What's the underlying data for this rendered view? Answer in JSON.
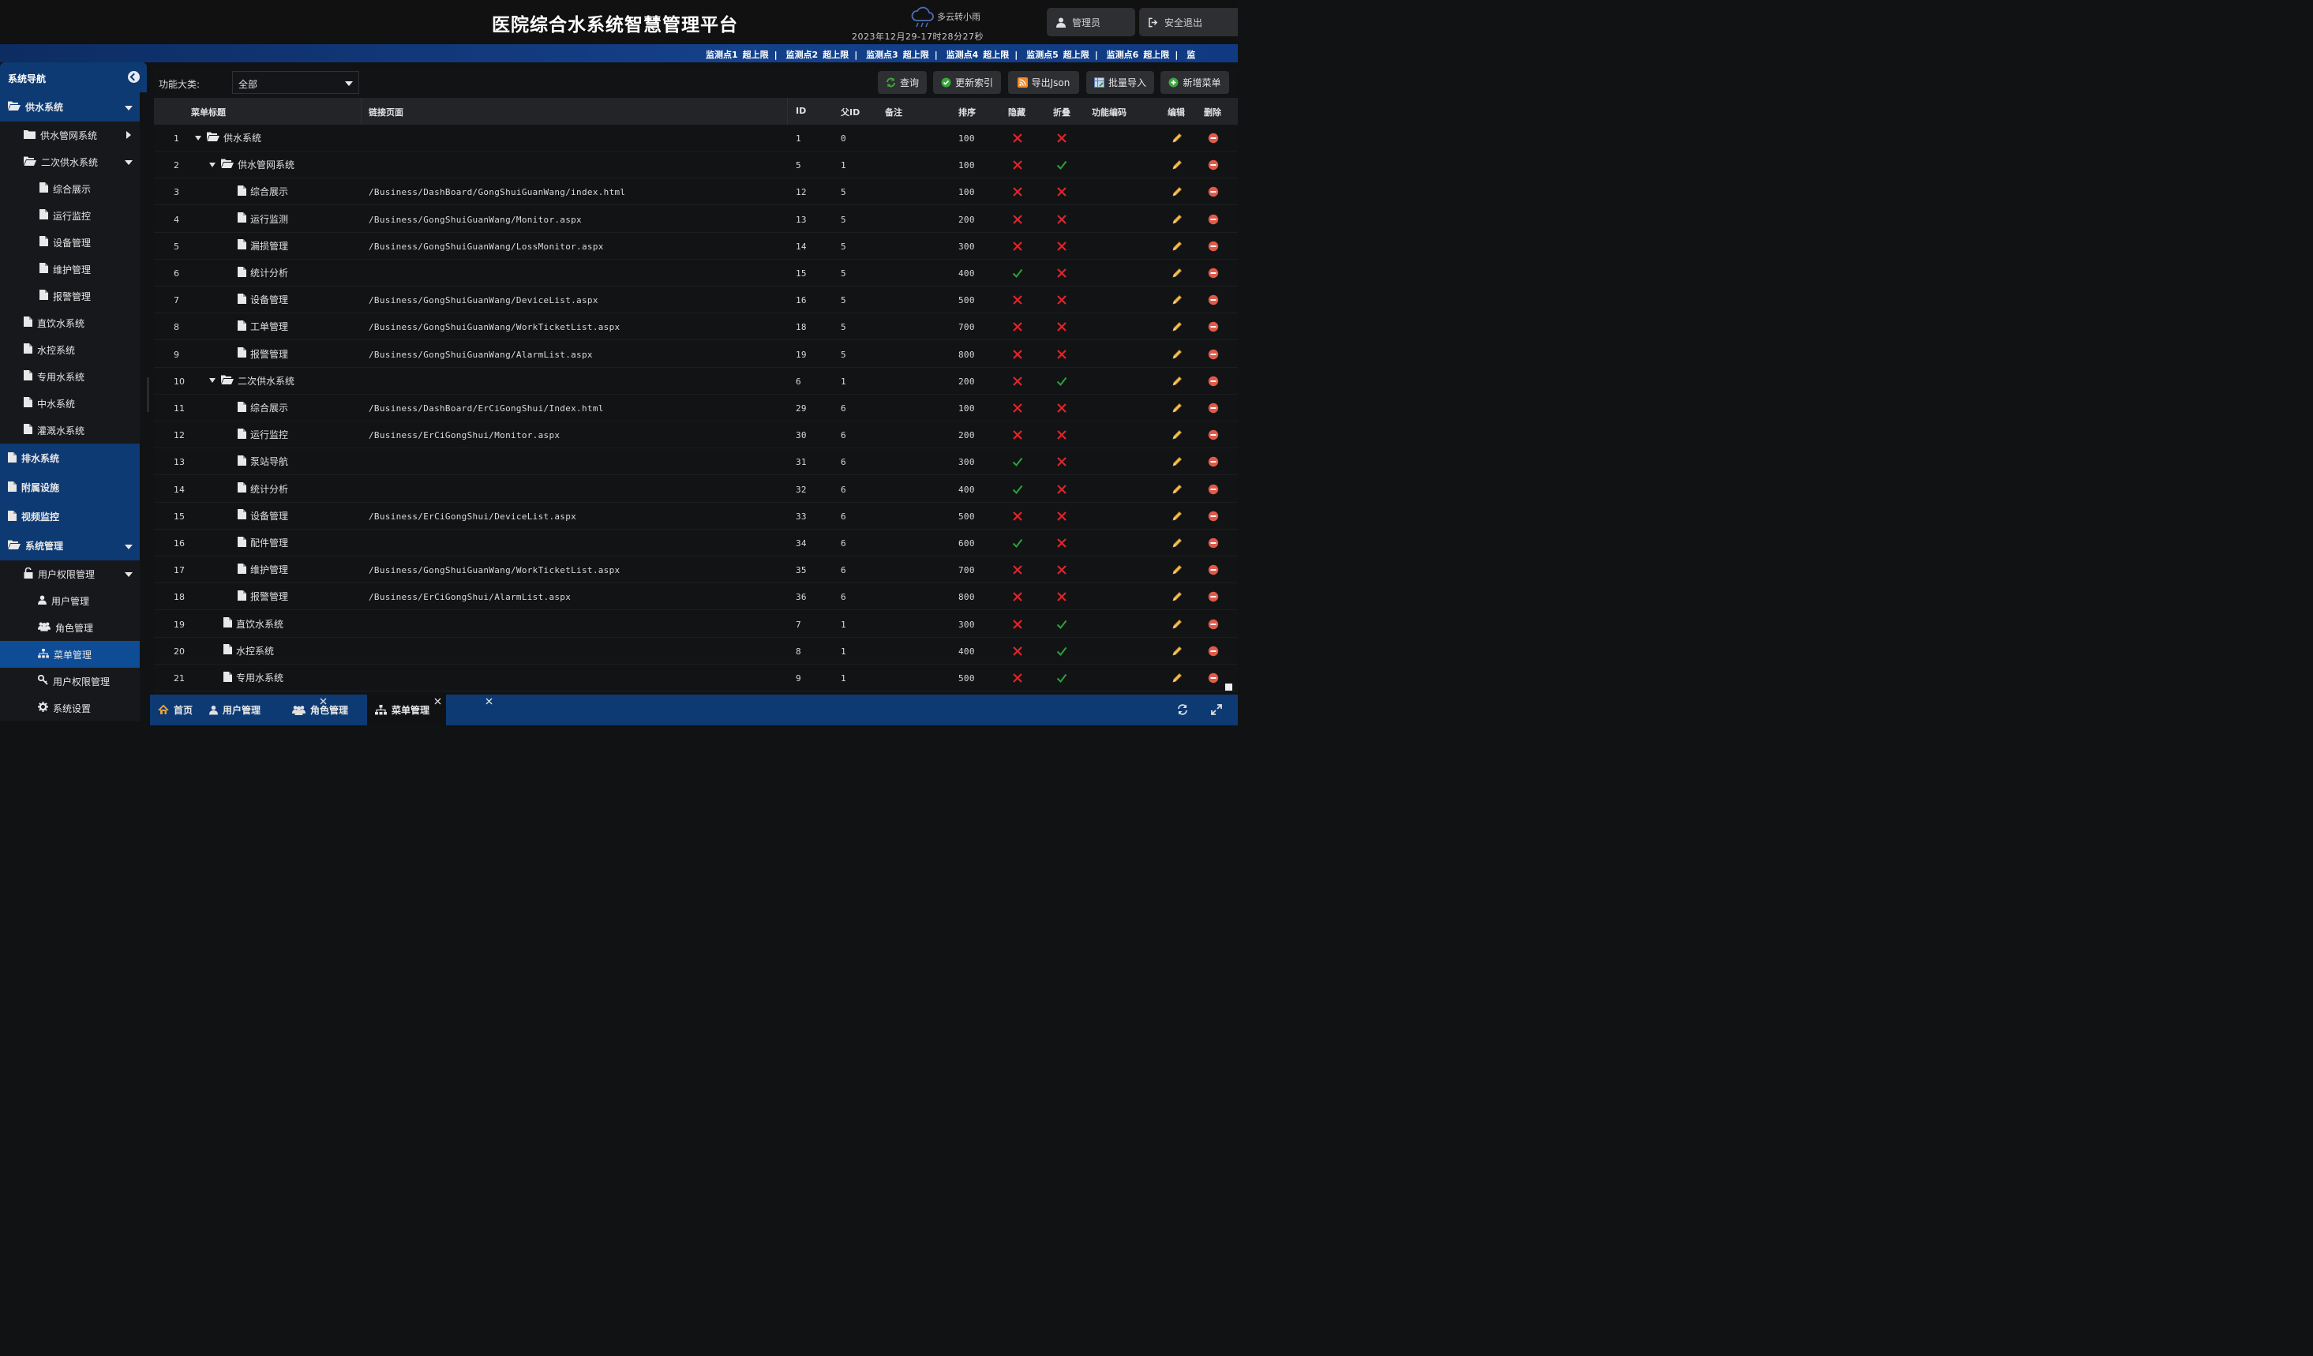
{
  "header": {
    "title": "医院综合水系统智慧管理平台",
    "weather": "多云转小雨",
    "datetime": "2023年12月29-17时28分27秒",
    "user_button": "管理员",
    "logout_button": "安全退出"
  },
  "ticker": {
    "items": [
      {
        "point": "监测点1",
        "status": "超上限"
      },
      {
        "point": "监测点2",
        "status": "超上限"
      },
      {
        "point": "监测点3",
        "status": "超上限"
      },
      {
        "point": "监测点4",
        "status": "超上限"
      },
      {
        "point": "监测点5",
        "status": "超上限"
      },
      {
        "point": "监测点6",
        "status": "超上限"
      }
    ],
    "tail": "监"
  },
  "sidebar": {
    "title": "系统导航",
    "items": [
      {
        "label": "供水系统"
      },
      {
        "label": "供水管网系统"
      },
      {
        "label": "二次供水系统"
      },
      {
        "label": "综合展示"
      },
      {
        "label": "运行监控"
      },
      {
        "label": "设备管理"
      },
      {
        "label": "维护管理"
      },
      {
        "label": "报警管理"
      },
      {
        "label": "直饮水系统"
      },
      {
        "label": "水控系统"
      },
      {
        "label": "专用水系统"
      },
      {
        "label": "中水系统"
      },
      {
        "label": "灌溉水系统"
      },
      {
        "label": "排水系统"
      },
      {
        "label": "附属设施"
      },
      {
        "label": "视频监控"
      },
      {
        "label": "系统管理"
      },
      {
        "label": "用户权限管理"
      },
      {
        "label": "用户管理"
      },
      {
        "label": "角色管理"
      },
      {
        "label": "菜单管理"
      },
      {
        "label": "用户权限管理"
      },
      {
        "label": "系统设置"
      }
    ]
  },
  "toolbar": {
    "filter_label": "功能大类:",
    "filter_value": "全部",
    "buttons": {
      "query": "查询",
      "reindex": "更新索引",
      "export": "导出Json",
      "import": "批量导入",
      "add": "新增菜单"
    }
  },
  "table": {
    "columns": {
      "title": "菜单标题",
      "link": "链接页面",
      "id": "ID",
      "pid": "父ID",
      "note": "备注",
      "sort": "排序",
      "hidden": "隐藏",
      "fold": "折叠",
      "code": "功能编码",
      "edit": "编辑",
      "delete": "删除"
    },
    "rows": [
      {
        "no": "1",
        "title": "供水系统",
        "link": "",
        "id": "1",
        "pid": "0",
        "sort": "100",
        "hidden": false,
        "fold": false
      },
      {
        "no": "2",
        "title": "供水管网系统",
        "link": "",
        "id": "5",
        "pid": "1",
        "sort": "100",
        "hidden": false,
        "fold": true
      },
      {
        "no": "3",
        "title": "综合展示",
        "link": "/Business/DashBoard/GongShuiGuanWang/index.html",
        "id": "12",
        "pid": "5",
        "sort": "100",
        "hidden": false,
        "fold": false
      },
      {
        "no": "4",
        "title": "运行监测",
        "link": "/Business/GongShuiGuanWang/Monitor.aspx",
        "id": "13",
        "pid": "5",
        "sort": "200",
        "hidden": false,
        "fold": false
      },
      {
        "no": "5",
        "title": "漏损管理",
        "link": "/Business/GongShuiGuanWang/LossMonitor.aspx",
        "id": "14",
        "pid": "5",
        "sort": "300",
        "hidden": false,
        "fold": false
      },
      {
        "no": "6",
        "title": "统计分析",
        "link": "",
        "id": "15",
        "pid": "5",
        "sort": "400",
        "hidden": true,
        "fold": false
      },
      {
        "no": "7",
        "title": "设备管理",
        "link": "/Business/GongShuiGuanWang/DeviceList.aspx",
        "id": "16",
        "pid": "5",
        "sort": "500",
        "hidden": false,
        "fold": false
      },
      {
        "no": "8",
        "title": "工单管理",
        "link": "/Business/GongShuiGuanWang/WorkTicketList.aspx",
        "id": "18",
        "pid": "5",
        "sort": "700",
        "hidden": false,
        "fold": false
      },
      {
        "no": "9",
        "title": "报警管理",
        "link": "/Business/GongShuiGuanWang/AlarmList.aspx",
        "id": "19",
        "pid": "5",
        "sort": "800",
        "hidden": false,
        "fold": false
      },
      {
        "no": "10",
        "title": "二次供水系统",
        "link": "",
        "id": "6",
        "pid": "1",
        "sort": "200",
        "hidden": false,
        "fold": true
      },
      {
        "no": "11",
        "title": "综合展示",
        "link": "/Business/DashBoard/ErCiGongShui/Index.html",
        "id": "29",
        "pid": "6",
        "sort": "100",
        "hidden": false,
        "fold": false
      },
      {
        "no": "12",
        "title": "运行监控",
        "link": "/Business/ErCiGongShui/Monitor.aspx",
        "id": "30",
        "pid": "6",
        "sort": "200",
        "hidden": false,
        "fold": false
      },
      {
        "no": "13",
        "title": "泵站导航",
        "link": "",
        "id": "31",
        "pid": "6",
        "sort": "300",
        "hidden": true,
        "fold": false
      },
      {
        "no": "14",
        "title": "统计分析",
        "link": "",
        "id": "32",
        "pid": "6",
        "sort": "400",
        "hidden": true,
        "fold": false
      },
      {
        "no": "15",
        "title": "设备管理",
        "link": "/Business/ErCiGongShui/DeviceList.aspx",
        "id": "33",
        "pid": "6",
        "sort": "500",
        "hidden": false,
        "fold": false
      },
      {
        "no": "16",
        "title": "配件管理",
        "link": "",
        "id": "34",
        "pid": "6",
        "sort": "600",
        "hidden": true,
        "fold": false
      },
      {
        "no": "17",
        "title": "维护管理",
        "link": "/Business/GongShuiGuanWang/WorkTicketList.aspx",
        "id": "35",
        "pid": "6",
        "sort": "700",
        "hidden": false,
        "fold": false
      },
      {
        "no": "18",
        "title": "报警管理",
        "link": "/Business/ErCiGongShui/AlarmList.aspx",
        "id": "36",
        "pid": "6",
        "sort": "800",
        "hidden": false,
        "fold": false
      },
      {
        "no": "19",
        "title": "直饮水系统",
        "link": "",
        "id": "7",
        "pid": "1",
        "sort": "300",
        "hidden": false,
        "fold": true
      },
      {
        "no": "20",
        "title": "水控系统",
        "link": "",
        "id": "8",
        "pid": "1",
        "sort": "400",
        "hidden": false,
        "fold": true
      },
      {
        "no": "21",
        "title": "专用水系统",
        "link": "",
        "id": "9",
        "pid": "1",
        "sort": "500",
        "hidden": false,
        "fold": true
      }
    ]
  },
  "tabs": [
    {
      "label": "首页"
    },
    {
      "label": "用户管理"
    },
    {
      "label": "角色管理"
    },
    {
      "label": "菜单管理"
    }
  ],
  "colors": {
    "accent": "#0d3a73",
    "active": "#0f4c96",
    "check": "#2aa33a",
    "cross": "#e0242a",
    "delete": "#e05a4a",
    "pencil": "#f0c04a"
  }
}
